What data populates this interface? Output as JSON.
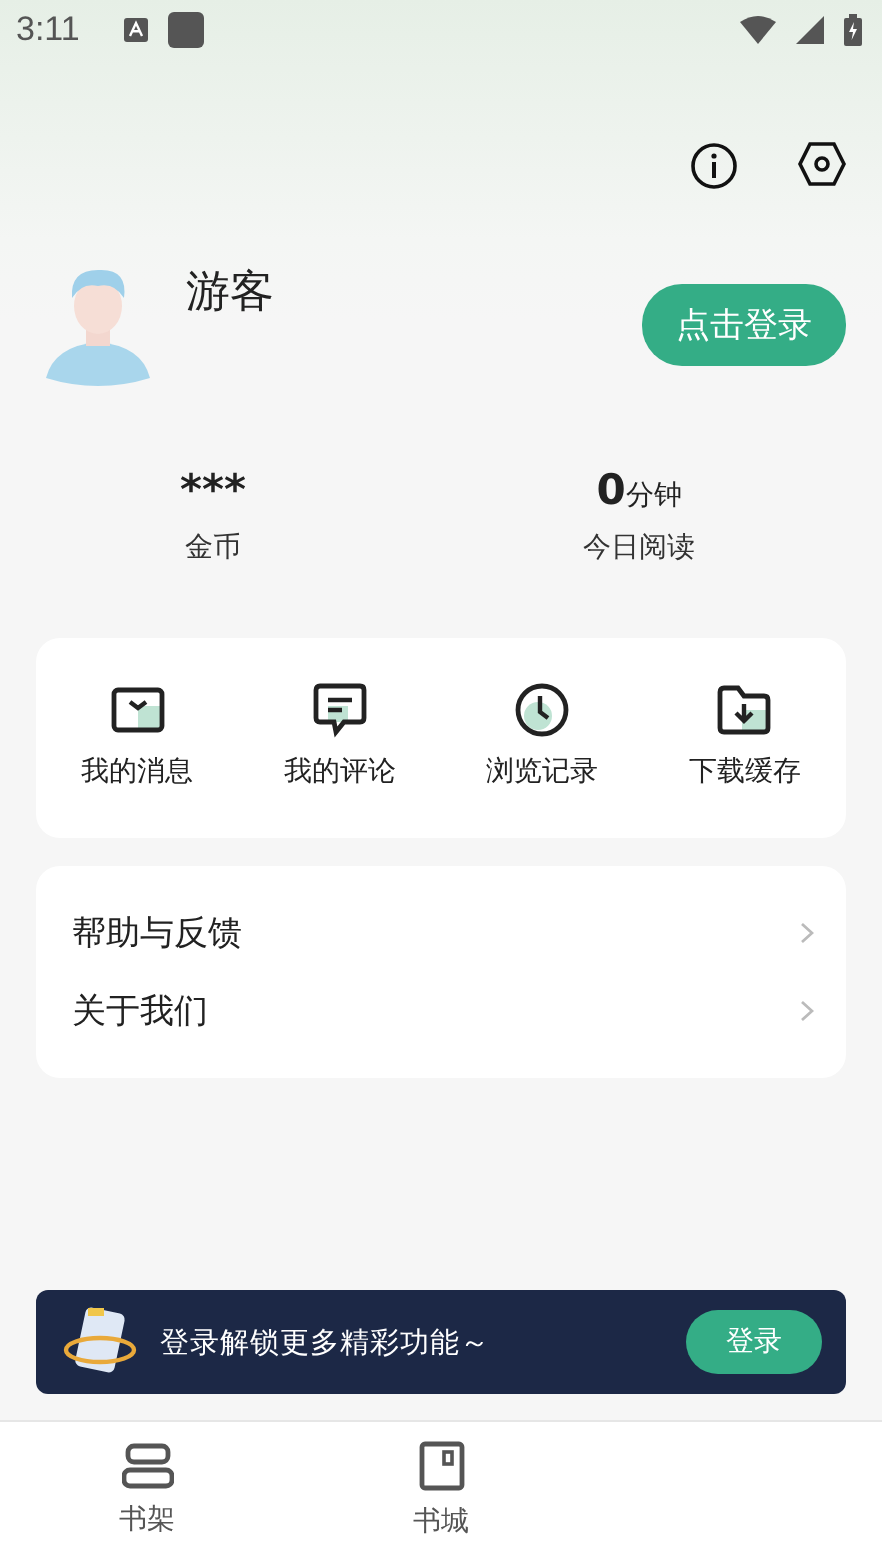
{
  "status_bar": {
    "time": "3:11"
  },
  "profile": {
    "name": "游客",
    "login_button": "点击登录"
  },
  "stats": [
    {
      "value": "***",
      "label": "金币"
    },
    {
      "value": "0",
      "unit": "分钟",
      "label": "今日阅读"
    }
  ],
  "shortcuts": [
    {
      "kind": "mail",
      "label": "我的消息"
    },
    {
      "kind": "comment",
      "label": "我的评论"
    },
    {
      "kind": "clock",
      "label": "浏览记录"
    },
    {
      "kind": "download",
      "label": "下载缓存"
    }
  ],
  "menu": [
    {
      "label": "帮助与反馈"
    },
    {
      "label": "关于我们"
    }
  ],
  "banner": {
    "text": "登录解锁更多精彩功能～",
    "button": "登录"
  },
  "bottom_nav": [
    {
      "kind": "shelf",
      "label": "书架",
      "selected": false
    },
    {
      "kind": "store",
      "label": "书城",
      "selected": false
    }
  ]
}
